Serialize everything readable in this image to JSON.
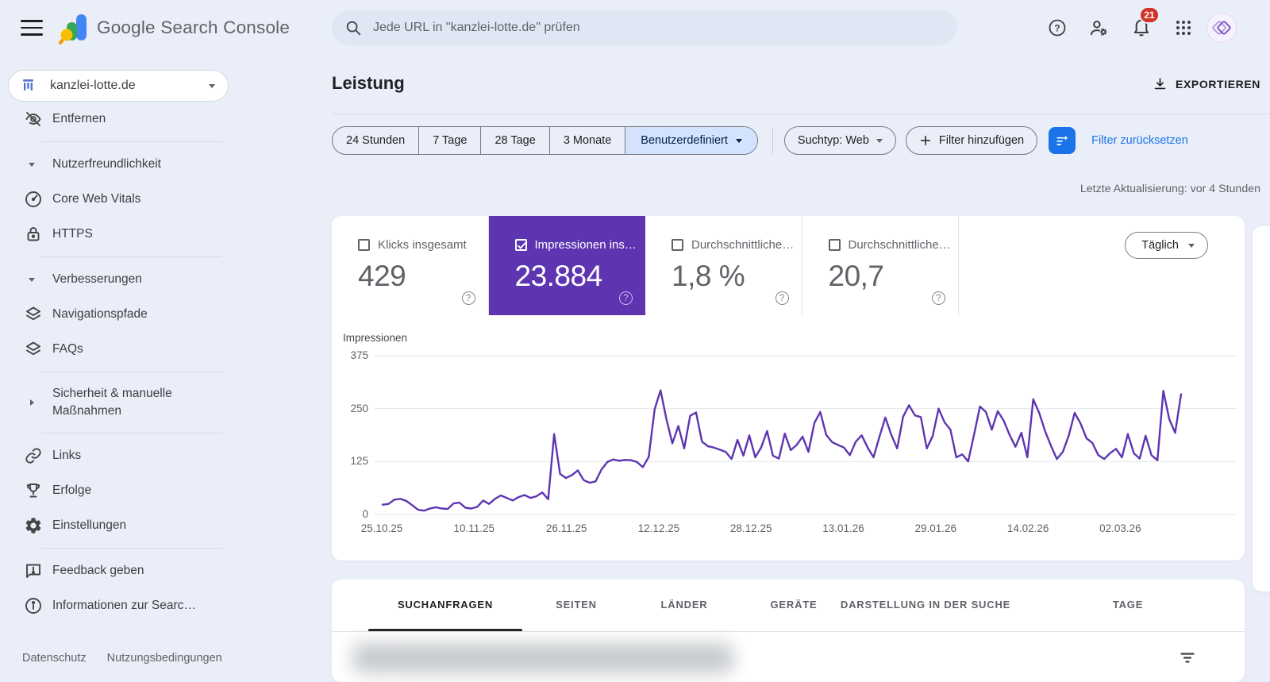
{
  "topbar": {
    "app_title": "Google Search Console",
    "search_placeholder": "Jede URL in \"kanzlei-lotte.de\" prüfen",
    "notification_count": "21"
  },
  "sidebar": {
    "property": {
      "label": "kanzlei-lotte.de"
    },
    "items": [
      {
        "type": "item",
        "icon": "eye-off",
        "label": "Entfernen"
      },
      {
        "type": "divider"
      },
      {
        "type": "section",
        "state": "expanded",
        "label": "Nutzerfreundlichkeit"
      },
      {
        "type": "item",
        "icon": "speedometer",
        "label": "Core Web Vitals"
      },
      {
        "type": "item",
        "icon": "lock",
        "label": "HTTPS"
      },
      {
        "type": "divider"
      },
      {
        "type": "section",
        "state": "expanded",
        "label": "Verbesserungen"
      },
      {
        "type": "item",
        "icon": "layers",
        "label": "Navigationspfade"
      },
      {
        "type": "item",
        "icon": "layers",
        "label": "FAQs"
      },
      {
        "type": "divider"
      },
      {
        "type": "section",
        "state": "collapsed",
        "label": "Sicherheit & manuelle<br>Maßnahmen",
        "two_line": true
      },
      {
        "type": "divider"
      },
      {
        "type": "item",
        "icon": "link",
        "label": "Links"
      },
      {
        "type": "item",
        "icon": "trophy",
        "label": "Erfolge"
      },
      {
        "type": "item",
        "icon": "gear",
        "label": "Einstellungen"
      },
      {
        "type": "divider"
      },
      {
        "type": "item",
        "icon": "feedback",
        "label": "Feedback geben"
      },
      {
        "type": "item",
        "icon": "info",
        "label": "Informationen zur Searc…"
      }
    ],
    "footer": [
      "Datenschutz",
      "Nutzungsbedingungen"
    ]
  },
  "header": {
    "title": "Leistung",
    "export_label": "EXPORTIEREN"
  },
  "filters": {
    "date_chips": [
      {
        "label": "24 Stunden",
        "selected": false
      },
      {
        "label": "7 Tage",
        "selected": false
      },
      {
        "label": "28 Tage",
        "selected": false
      },
      {
        "label": "3 Monate",
        "selected": false
      },
      {
        "label": "Benutzerdefiniert",
        "selected": true
      }
    ],
    "search_type": "Suchtyp: Web",
    "add_filter_label": "Filter hinzufügen",
    "reset_label": "Filter zurücksetzen"
  },
  "status": {
    "last_update": "Letzte Aktualisierung: vor 4 Stunden"
  },
  "metrics": [
    {
      "id": "clicks",
      "label": "Klicks insgesamt",
      "value": "429",
      "checked": false,
      "selected": false
    },
    {
      "id": "impressions",
      "label": "Impressionen ins…",
      "value": "23.884",
      "checked": true,
      "selected": true
    },
    {
      "id": "ctr",
      "label": "Durchschnittliche…",
      "value": "1,8 %",
      "checked": false,
      "selected": false
    },
    {
      "id": "position",
      "label": "Durchschnittliche…",
      "value": "20,7",
      "checked": false,
      "selected": false
    }
  ],
  "granularity": {
    "label": "Täglich"
  },
  "chart_data": {
    "type": "line",
    "series_label": "Impressionen",
    "ylim": [
      0,
      375
    ],
    "y_ticks": [
      375,
      250,
      125,
      0
    ],
    "x_tick_labels": [
      "25.10.25",
      "10.11.25",
      "26.11.25",
      "12.12.25",
      "28.12.25",
      "13.01.26",
      "29.01.26",
      "14.02.26",
      "02.03.26"
    ],
    "x_unit": "day",
    "line_color": "#5e35b1",
    "grid": true,
    "values": [
      23,
      25,
      35,
      37,
      32,
      22,
      11,
      9,
      14,
      17,
      14,
      13,
      26,
      28,
      16,
      14,
      18,
      33,
      25,
      37,
      45,
      39,
      33,
      41,
      46,
      39,
      43,
      52,
      36,
      190,
      96,
      86,
      93,
      104,
      81,
      75,
      78,
      106,
      124,
      130,
      127,
      129,
      128,
      124,
      112,
      136,
      249,
      293,
      224,
      168,
      209,
      156,
      233,
      241,
      172,
      161,
      158,
      153,
      148,
      131,
      176,
      139,
      187,
      135,
      158,
      197,
      139,
      132,
      191,
      152,
      164,
      184,
      148,
      216,
      242,
      188,
      171,
      164,
      158,
      140,
      172,
      187,
      158,
      135,
      184,
      229,
      188,
      156,
      231,
      258,
      234,
      230,
      156,
      185,
      250,
      218,
      200,
      135,
      142,
      125,
      189,
      255,
      242,
      200,
      244,
      222,
      188,
      160,
      193,
      135,
      272,
      240,
      197,
      162,
      131,
      148,
      186,
      240,
      215,
      180,
      169,
      140,
      131,
      145,
      155,
      135,
      190,
      145,
      132,
      186,
      140,
      128,
      292,
      225,
      193,
      284
    ]
  },
  "tabs": [
    {
      "label": "SUCHANFRAGEN",
      "active": true
    },
    {
      "label": "SEITEN",
      "active": false
    },
    {
      "label": "LÄNDER",
      "active": false
    },
    {
      "label": "GERÄTE",
      "active": false
    },
    {
      "label": "DARSTELLUNG IN DER SUCHE",
      "active": false
    },
    {
      "label": "TAGE",
      "active": false
    }
  ],
  "colors": {
    "accent_blue": "#1a73e8",
    "selected_chip_bg": "#d3e3fd",
    "impressions_purple": "#5e35b1",
    "badge_red": "#d33228",
    "page_bg": "#eaeef8"
  }
}
